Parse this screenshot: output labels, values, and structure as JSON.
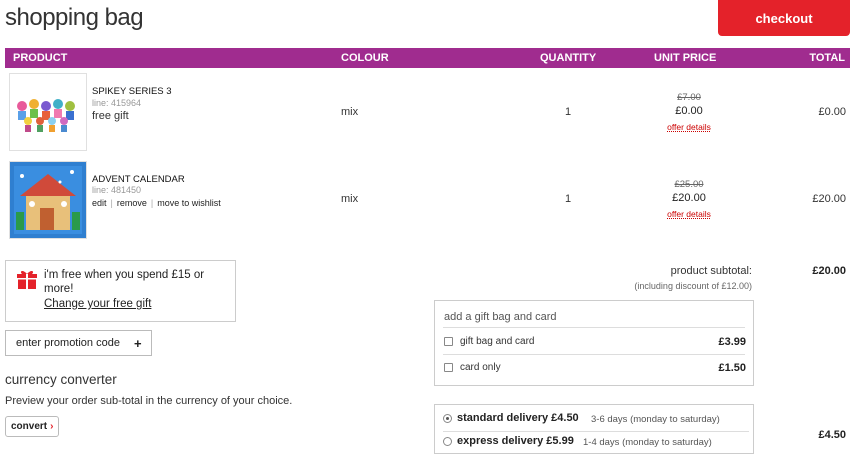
{
  "header": {
    "title": "shopping bag",
    "checkout_label": "checkout"
  },
  "table": {
    "headers": {
      "product": "PRODUCT",
      "colour": "COLOUR",
      "quantity": "QUANTITY",
      "unit_price": "UNIT PRICE",
      "total": "TOTAL"
    },
    "rows": [
      {
        "name": "SPIKEY SERIES 3",
        "line": "line: 415964",
        "note": "free gift",
        "colour": "mix",
        "quantity": "1",
        "was_price": "£7.00",
        "price": "£0.00",
        "offer": "offer details",
        "total": "£0.00"
      },
      {
        "name": "ADVENT CALENDAR",
        "line": "line: 481450",
        "actions": {
          "edit": "edit",
          "remove": "remove",
          "wishlist": "move to wishlist"
        },
        "colour": "mix",
        "quantity": "1",
        "was_price": "£25.00",
        "price": "£20.00",
        "offer": "offer details",
        "total": "£20.00"
      }
    ]
  },
  "free_gift": {
    "text": "i'm free when you spend £15 or more!",
    "link": "Change your free gift"
  },
  "promo": {
    "label": "enter promotion code",
    "icon": "plus-icon"
  },
  "currency": {
    "title": "currency converter",
    "desc": "Preview your order sub-total in the currency of your choice.",
    "button": "convert"
  },
  "summary": {
    "subtotal_label": "product subtotal:",
    "discount_note": "(including discount of £12.00)",
    "subtotal_value": "£20.00"
  },
  "gift_options": {
    "title": "add a gift bag and card",
    "items": [
      {
        "label": "gift bag and card",
        "price": "£3.99"
      },
      {
        "label": "card only",
        "price": "£1.50"
      }
    ]
  },
  "delivery": {
    "options": [
      {
        "label": "standard delivery £4.50",
        "detail": "3-6 days (monday to saturday)",
        "selected": true
      },
      {
        "label": "express delivery £5.99",
        "detail": "1-4 days (monday to saturday)",
        "selected": false
      }
    ],
    "value": "£4.50"
  },
  "colors": {
    "accent": "#a02c8f",
    "checkout": "#e4222a",
    "offer": "#cc0000"
  }
}
